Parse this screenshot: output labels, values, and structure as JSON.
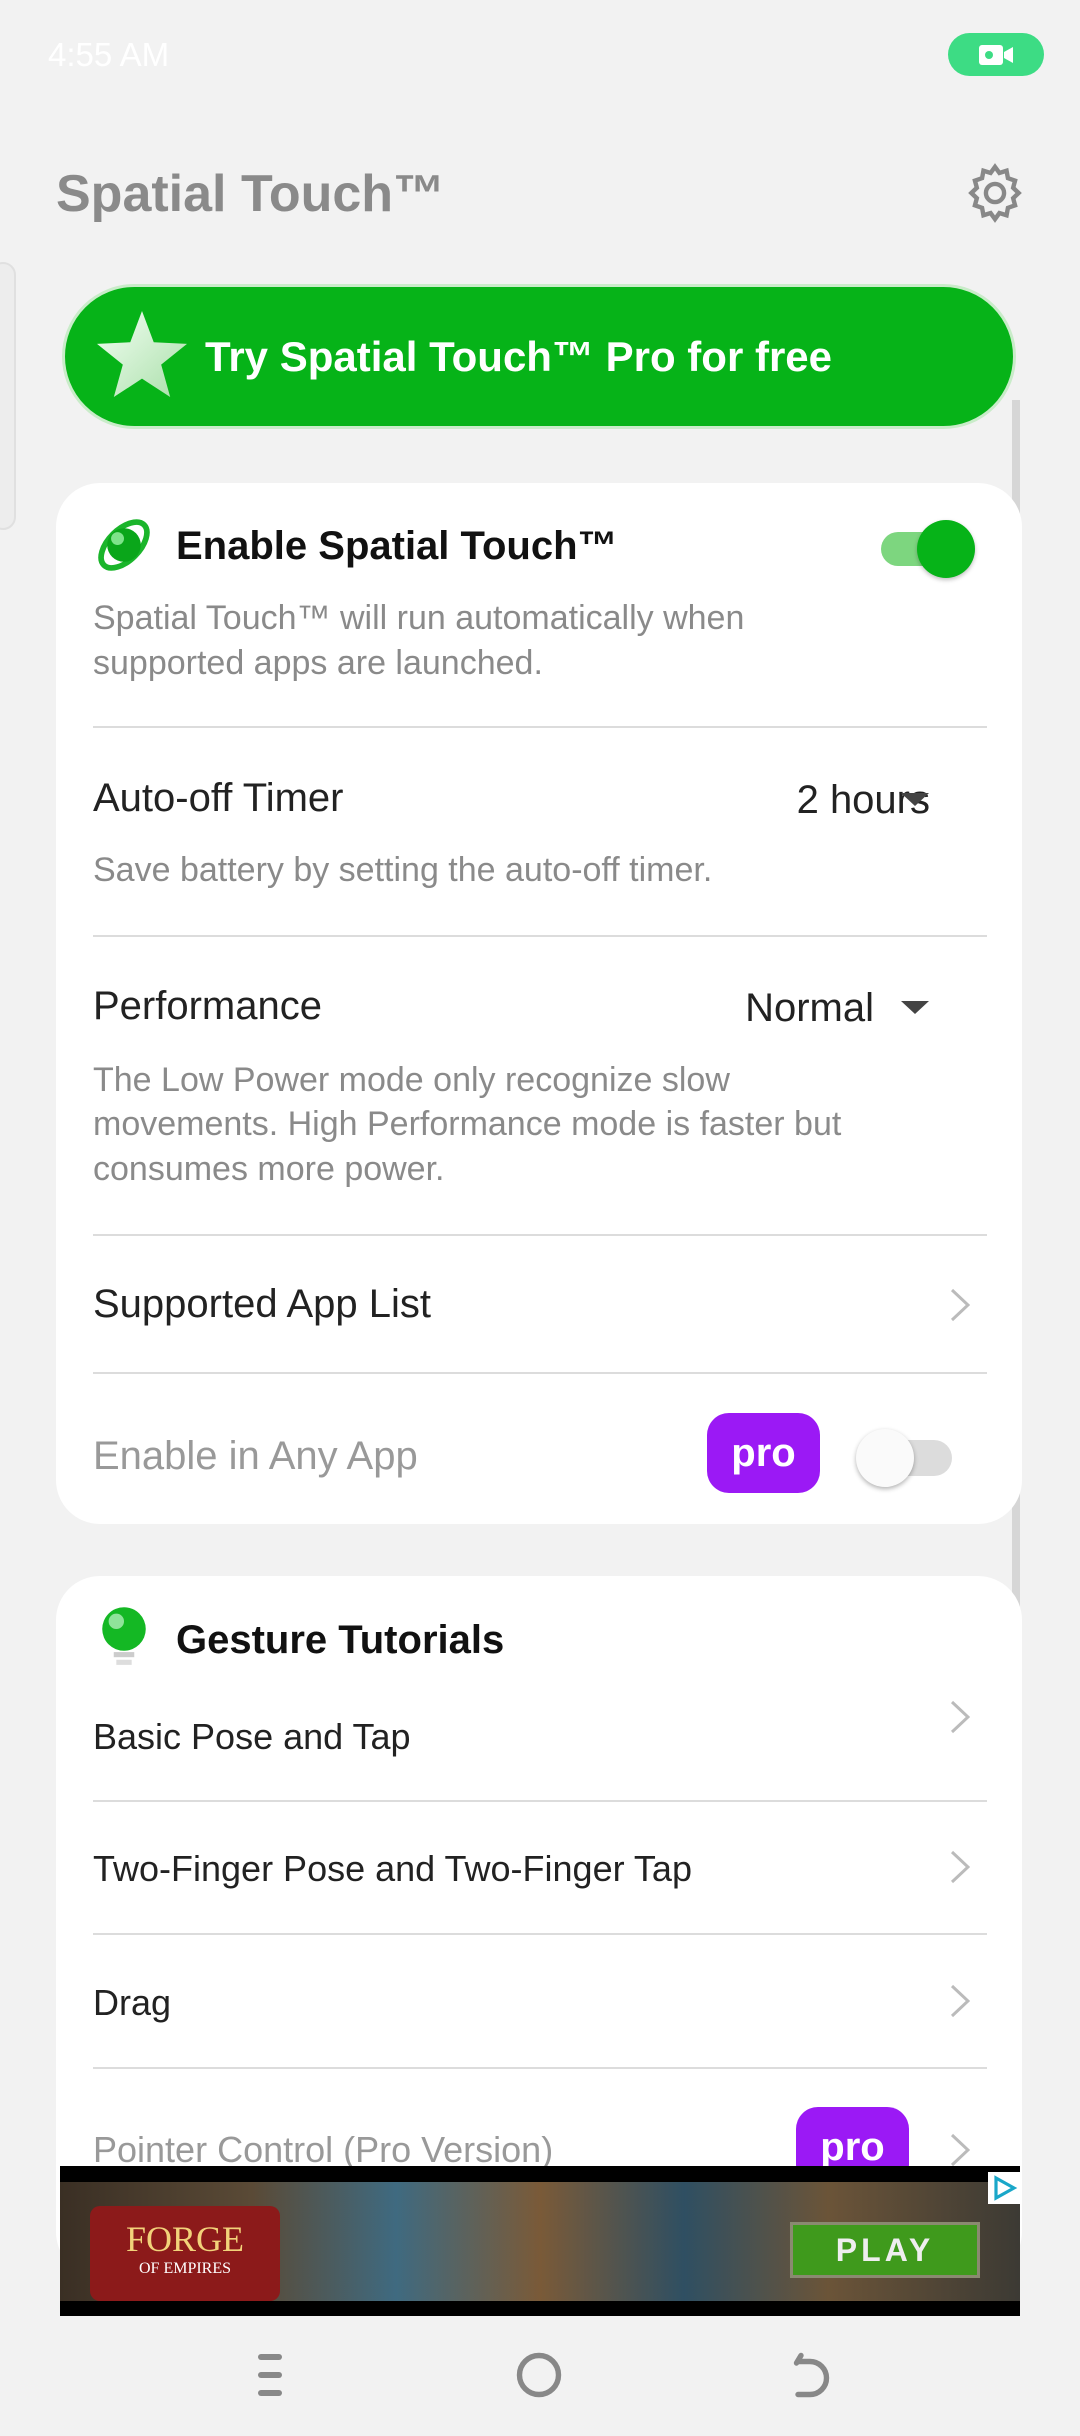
{
  "status_bar": {
    "time": "4:55 AM",
    "record_icon": "video-camera-icon"
  },
  "header": {
    "title": "Spatial Touch™",
    "settings_icon": "gear-icon"
  },
  "banner": {
    "label": "Try Spatial Touch™ Pro for free",
    "icon": "star-icon",
    "color": "#06b318"
  },
  "main_card": {
    "enable": {
      "title": "Enable Spatial Touch™",
      "description_line1": "Spatial Touch™ will run automatically when",
      "description_line2": "supported apps are launched.",
      "toggle_on": true
    },
    "auto_off": {
      "title": "Auto-off Timer",
      "value": "2 hours",
      "description": "Save battery by setting the auto-off timer."
    },
    "performance": {
      "title": "Performance",
      "value": "Normal",
      "description_line1": "The Low Power mode only recognize slow",
      "description_line2": "movements. High Performance mode is faster but",
      "description_line3": "consumes more power."
    },
    "supported_apps": {
      "title": "Supported App List"
    },
    "any_app": {
      "title": "Enable in Any App",
      "badge": "pro",
      "toggle_on": false
    }
  },
  "tutorials": {
    "title": "Gesture Tutorials",
    "items": [
      {
        "label": "Basic Pose and Tap"
      },
      {
        "label": "Two-Finger Pose and Two-Finger Tap"
      },
      {
        "label": "Drag"
      },
      {
        "label": "Pointer Control (Pro Version)",
        "badge": "pro"
      }
    ]
  },
  "ad": {
    "brand_line1": "FORGE",
    "brand_line2": "OF EMPIRES",
    "cta": "PLAY"
  },
  "colors": {
    "accent_green": "#06b318",
    "pro_purple": "#9b19f5",
    "toggle_green": "#06b318"
  }
}
